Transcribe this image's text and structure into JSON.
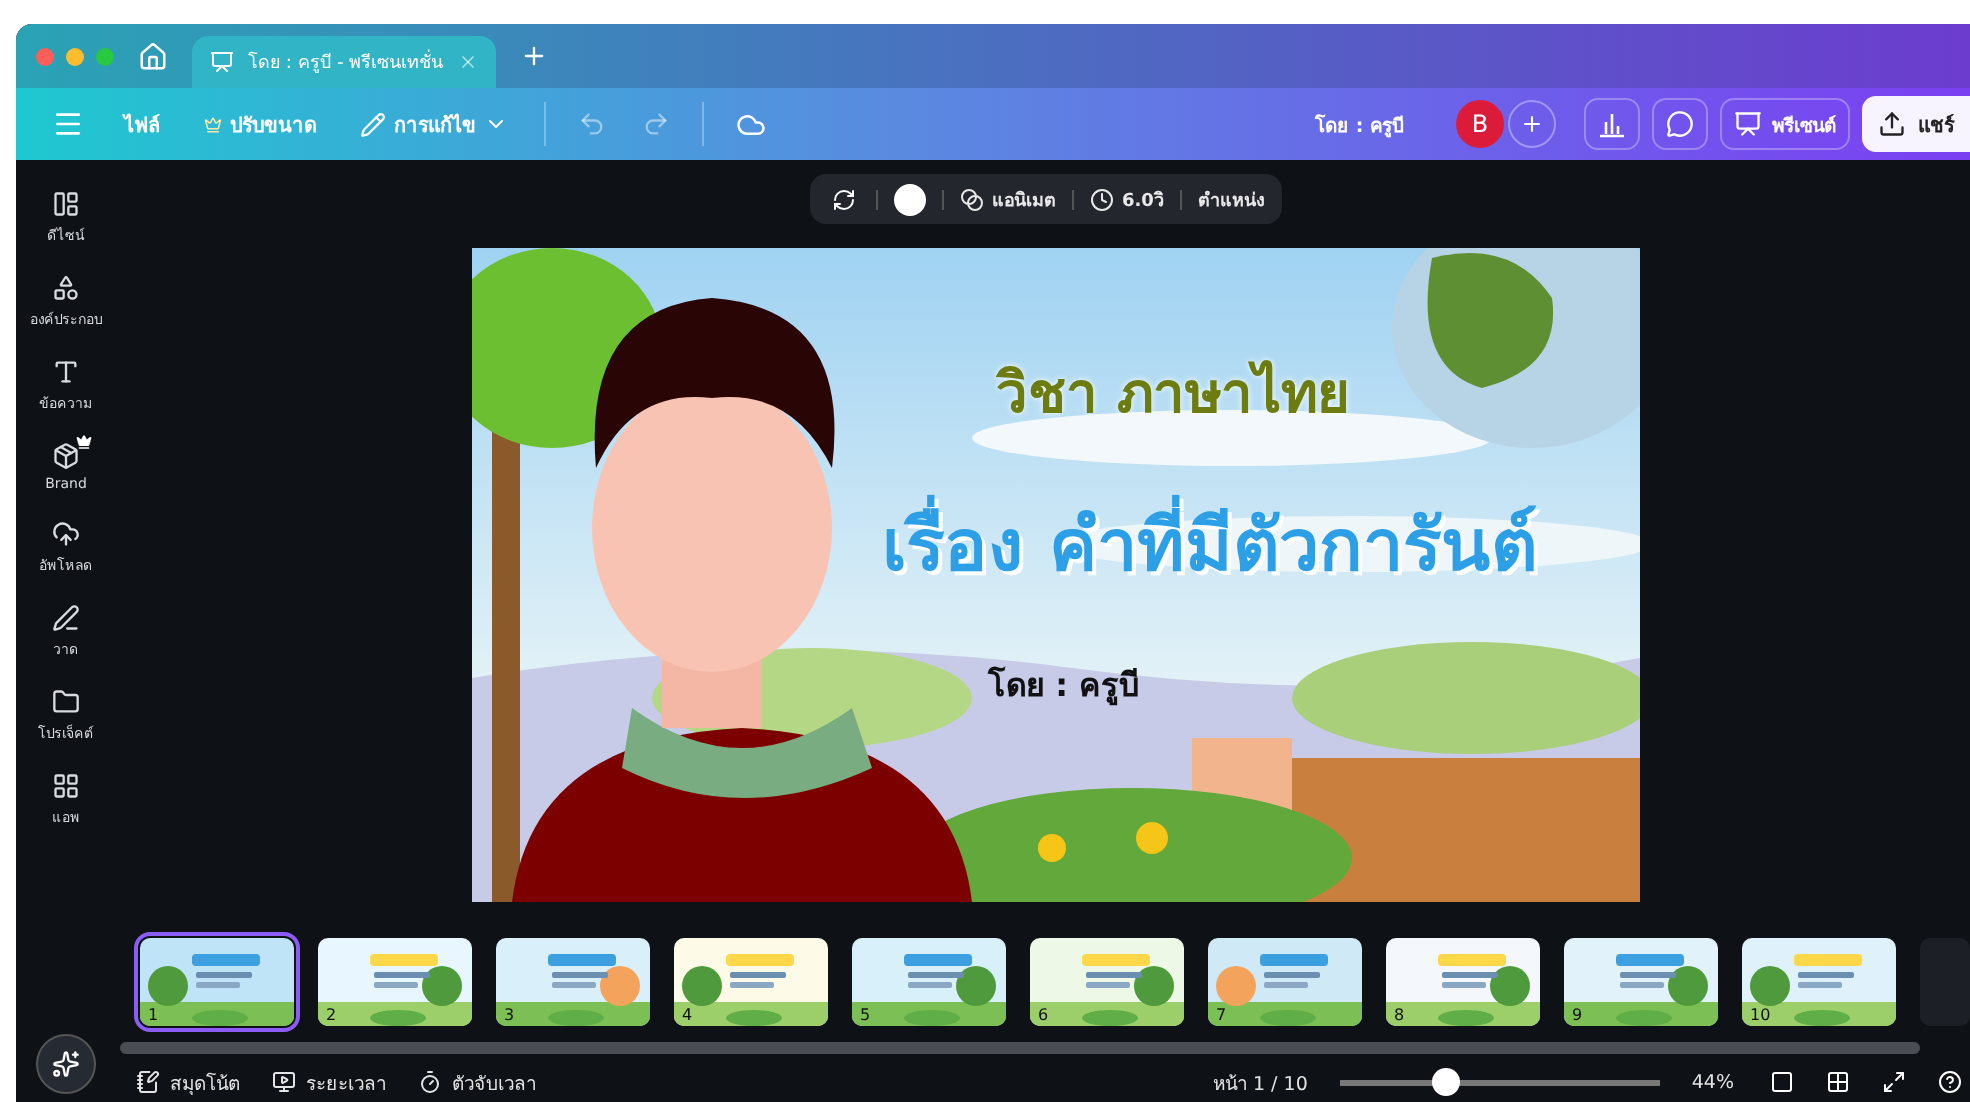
{
  "window": {
    "tabs": [
      {
        "title": "โดย : ครูบี - พรีเซนเทชั่น",
        "selected": true
      }
    ]
  },
  "toolbar": {
    "file": "ไฟล์",
    "resize": "ปรับขนาด",
    "edit": "การแก้ไข",
    "undo": {
      "disabled": true
    },
    "redo": {
      "disabled": true
    },
    "author": "โดย : ครูบี",
    "avatar": "B",
    "present": "พรีเซนต์",
    "share": "แชร์"
  },
  "sidebar": {
    "items": [
      {
        "label": "ดีไซน์",
        "premium": false
      },
      {
        "label": "องค์ประกอบ",
        "premium": false
      },
      {
        "label": "ข้อความ",
        "premium": false
      },
      {
        "label": "Brand",
        "premium": true
      },
      {
        "label": "อัพโหลด",
        "premium": false
      },
      {
        "label": "วาด",
        "premium": false
      },
      {
        "label": "โปรเจ็คต์",
        "premium": false
      },
      {
        "label": "แอพ",
        "premium": false
      }
    ]
  },
  "element_toolbar": {
    "animate": "แอนิเมต",
    "duration": "6.0วิ",
    "position": "ตำแหน่ง"
  },
  "slide": {
    "subject": "วิชา ภาษาไทย",
    "title": "เรื่อง คำที่มีตัวการันต์",
    "author": "โดย : ครูบี"
  },
  "pages": [
    {
      "number": "1",
      "selected": true
    },
    {
      "number": "2",
      "selected": false
    },
    {
      "number": "3",
      "selected": false
    },
    {
      "number": "4",
      "selected": false
    },
    {
      "number": "5",
      "selected": false
    },
    {
      "number": "6",
      "selected": false
    },
    {
      "number": "7",
      "selected": false
    },
    {
      "number": "8",
      "selected": false
    },
    {
      "number": "9",
      "selected": false
    },
    {
      "number": "10",
      "selected": false
    }
  ],
  "footer": {
    "notes": "สมุดโน้ต",
    "duration": "ระยะเวลา",
    "timer": "ตัวจับเวลา",
    "page": "หน้า 1 / 10",
    "zoom": {
      "level": 0.33,
      "reading": "44%"
    }
  }
}
